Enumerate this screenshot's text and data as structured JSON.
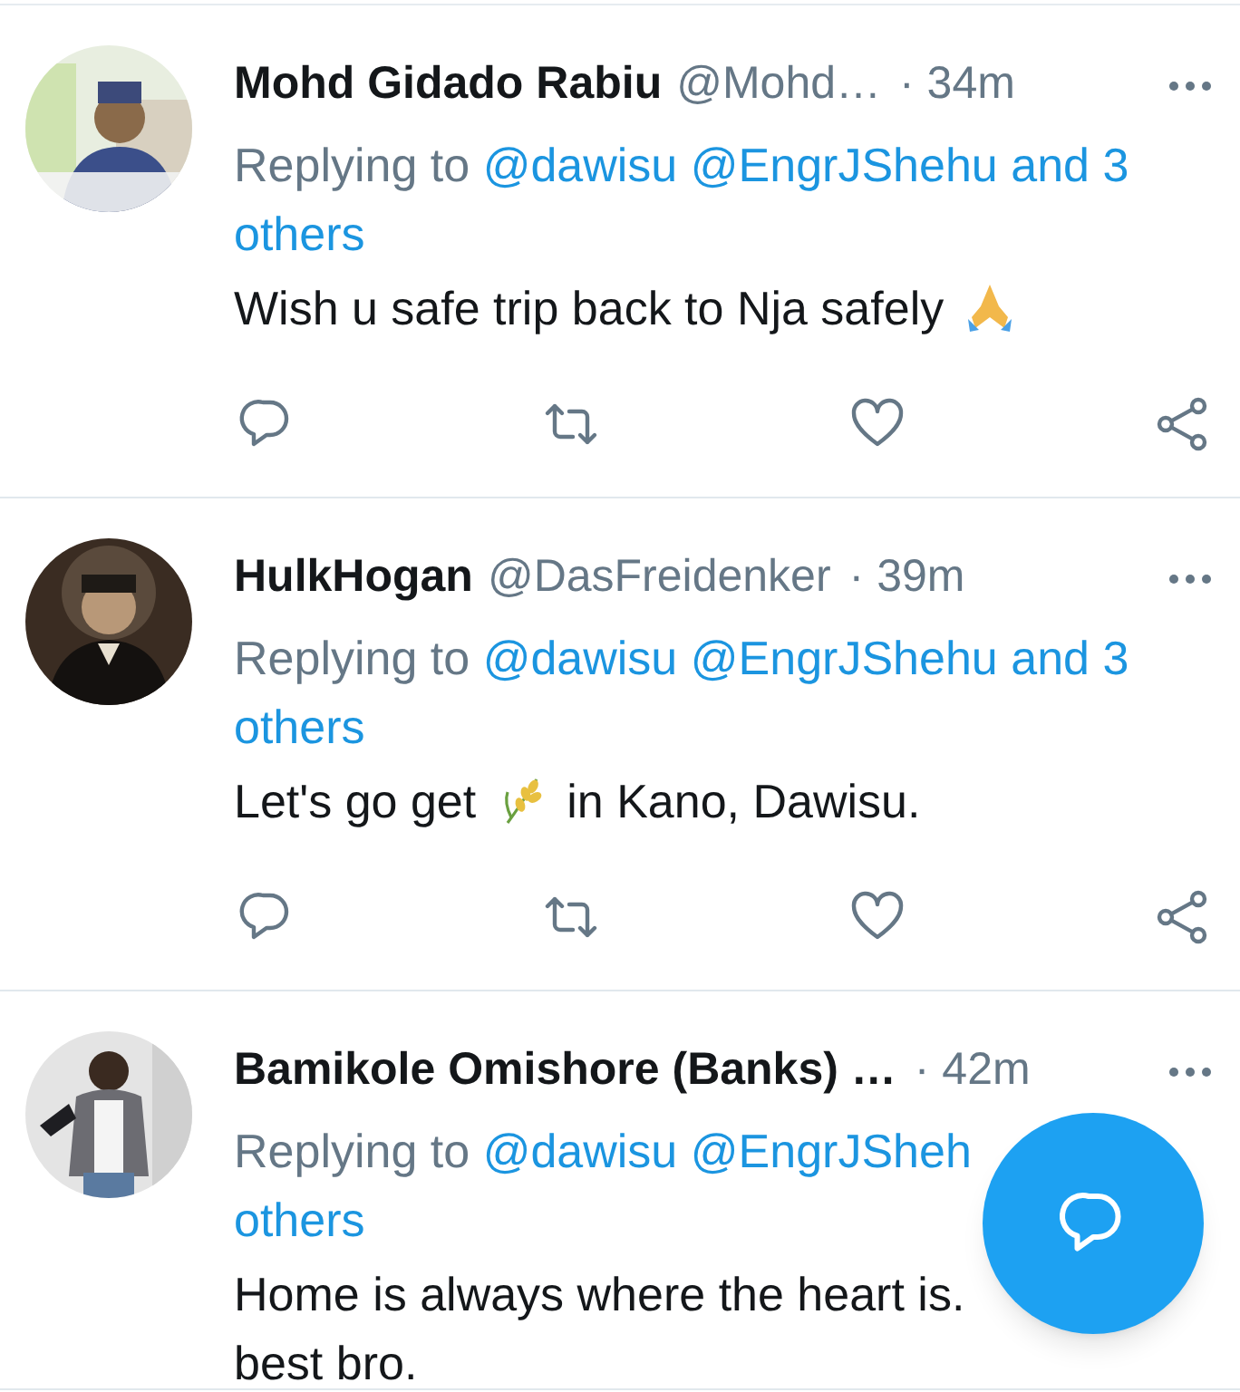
{
  "tweets": [
    {
      "name": "Mohd Gidado Rabiu",
      "handle": "@Mohd…",
      "time": "· 34m",
      "avatar": {
        "kind": "picture"
      },
      "reply_to": {
        "label": "Replying to",
        "links": [
          "@dawisu",
          "@EngrJShehu",
          "and 3"
        ],
        "next_line": "others"
      },
      "body": [
        [
          {
            "kind": "text",
            "text": "Wish u safe trip back to Nja safely"
          },
          {
            "kind": "hands"
          }
        ]
      ],
      "actions": [
        {
          "kind": "reply"
        },
        {
          "kind": "retweet"
        },
        {
          "kind": "like"
        },
        {
          "kind": "share"
        }
      ]
    },
    {
      "name": "HulkHogan",
      "handle": "@DasFreidenker",
      "time": "· 39m",
      "avatar": {
        "kind": "picture"
      },
      "reply_to": {
        "label": "Replying to",
        "links": [
          "@dawisu",
          "@EngrJShehu",
          "and 3"
        ],
        "next_line": "others"
      },
      "body": [
        [
          {
            "kind": "text",
            "text": "Let's go get"
          },
          {
            "kind": "wheat"
          },
          {
            "kind": "text",
            "text": "in Kano, Dawisu."
          }
        ]
      ],
      "actions": [
        {
          "kind": "reply"
        },
        {
          "kind": "retweet"
        },
        {
          "kind": "like"
        },
        {
          "kind": "share"
        }
      ]
    },
    {
      "name": "Bamikole Omishore (Banks) …",
      "time": "· 42m",
      "avatar": {
        "kind": "picture"
      },
      "reply_to": {
        "label": "Replying to",
        "links": [
          "@dawisu",
          "@EngrJSheh"
        ],
        "next_line": "others"
      },
      "body": [
        [
          {
            "kind": "text",
            "text": "Home is always where the heart is."
          }
        ],
        [
          {
            "kind": "text",
            "text": "best bro."
          }
        ]
      ]
    }
  ],
  "compose_button": {
    "kind": "fab"
  }
}
